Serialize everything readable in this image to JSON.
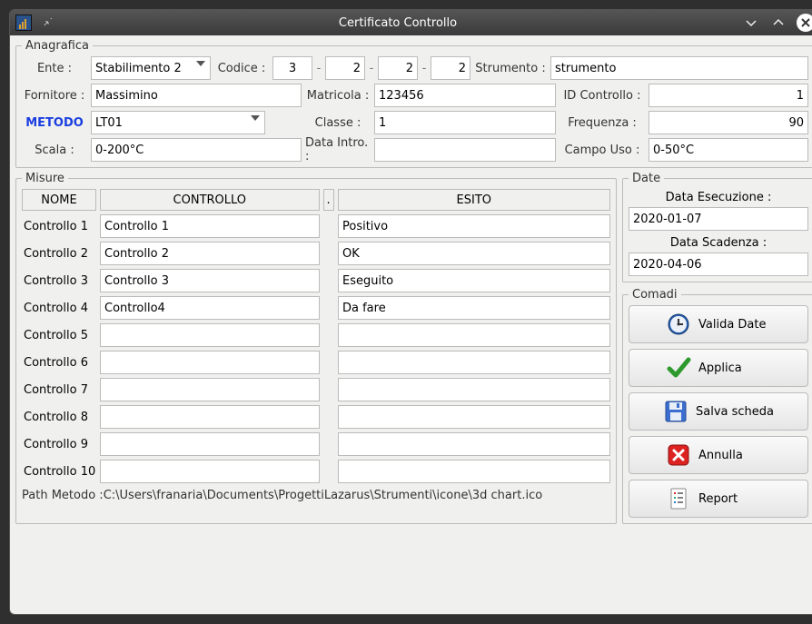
{
  "window": {
    "title": "Certificato Controllo"
  },
  "anagrafica": {
    "legend": "Anagrafica",
    "ente_label": "Ente :",
    "ente_value": "Stabilimento 2",
    "codice_label": "Codice :",
    "codice_parts": [
      "3",
      "2",
      "2",
      "2"
    ],
    "strumento_label": "Strumento :",
    "strumento_value": "strumento",
    "fornitore_label": "Fornitore :",
    "fornitore_value": "Massimino",
    "matricola_label": "Matricola :",
    "matricola_value": "123456",
    "id_controllo_label": "ID Controllo :",
    "id_controllo_value": "1",
    "metodo_label": "METODO",
    "metodo_value": "LT01",
    "classe_label": "Classe :",
    "classe_value": "1",
    "frequenza_label": "Frequenza :",
    "frequenza_value": "90",
    "scala_label": "Scala :",
    "scala_value": "0-200°C",
    "data_intro_label": "Data Intro. :",
    "data_intro_value": "",
    "campo_uso_label": "Campo Uso :",
    "campo_uso_value": "0-50°C"
  },
  "misure": {
    "legend": "Misure",
    "header_name": "NOME",
    "header_controllo": "CONTROLLO",
    "header_dot": ".",
    "header_esito": "ESITO",
    "rows": [
      {
        "name": "Controllo 1",
        "controllo": "Controllo 1",
        "esito": "Positivo"
      },
      {
        "name": "Controllo 2",
        "controllo": "Controllo 2",
        "esito": "OK"
      },
      {
        "name": "Controllo 3",
        "controllo": "Controllo 3",
        "esito": "Eseguito"
      },
      {
        "name": "Controllo 4",
        "controllo": "Controllo4",
        "esito": "Da fare"
      },
      {
        "name": "Controllo 5",
        "controllo": "",
        "esito": ""
      },
      {
        "name": "Controllo 6",
        "controllo": "",
        "esito": ""
      },
      {
        "name": "Controllo 7",
        "controllo": "",
        "esito": ""
      },
      {
        "name": "Controllo 8",
        "controllo": "",
        "esito": ""
      },
      {
        "name": "Controllo 9",
        "controllo": "",
        "esito": ""
      },
      {
        "name": "Controllo 10",
        "controllo": "",
        "esito": ""
      }
    ],
    "path_prefix": "Path Metodo :",
    "path_value": "C:\\Users\\franaria\\Documents\\ProgettiLazarus\\Strumenti\\icone\\3d chart.ico"
  },
  "date": {
    "legend": "Date",
    "esecuzione_label": "Data Esecuzione :",
    "esecuzione_value": "2020-01-07",
    "scadenza_label": "Data Scadenza :",
    "scadenza_value": "2020-04-06"
  },
  "comandi": {
    "legend": "Comadi",
    "valida_date": "Valida Date",
    "applica": "Applica",
    "salva_scheda": "Salva scheda",
    "annulla": "Annulla",
    "report": "Report"
  }
}
